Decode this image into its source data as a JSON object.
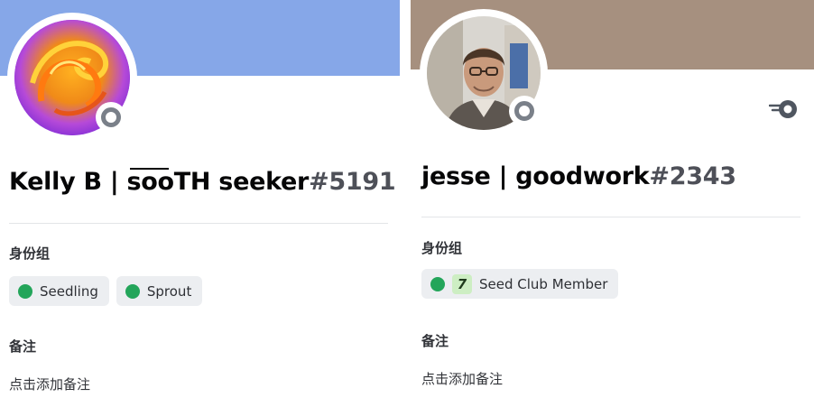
{
  "colors": {
    "left_banner": "#86a7e8",
    "right_banner": "#a6907f",
    "role_dot_green": "#23a55a",
    "status_offline": "#7a8089"
  },
  "left_profile": {
    "name_prefix": "Kelly B | ",
    "name_overlined": "soo",
    "name_suffix": "TH seeker",
    "discriminator": "#5191",
    "roles_title": "身份组",
    "roles": [
      {
        "name": "Seedling"
      },
      {
        "name": "Sprout"
      }
    ],
    "note_title": "备注",
    "note_placeholder": "点击添加备注",
    "status": "offline"
  },
  "right_profile": {
    "name": "jesse | goodwork",
    "discriminator": "#2343",
    "roles_title": "身份组",
    "roles": [
      {
        "name": "Seed Club Member",
        "icon_glyph": "7"
      }
    ],
    "note_title": "备注",
    "note_placeholder": "点击添加备注",
    "status": "offline",
    "badge": "nitro-icon"
  }
}
